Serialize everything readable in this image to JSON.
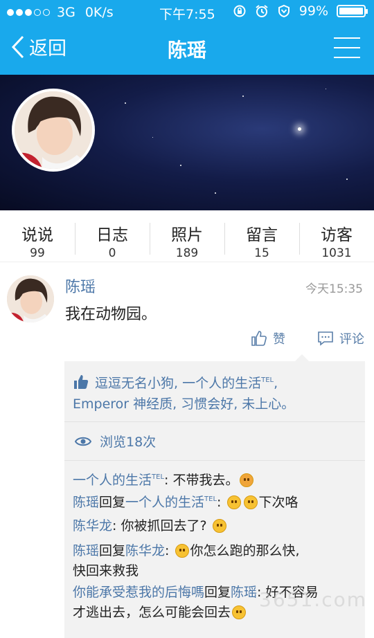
{
  "status": {
    "network": "3G",
    "speed": "0K/s",
    "time": "下午7:55",
    "battery": "99%",
    "battery_level": 0.99
  },
  "nav": {
    "back_label": "返回",
    "title": "陈瑶"
  },
  "stats": [
    {
      "label": "说说",
      "value": "99"
    },
    {
      "label": "日志",
      "value": "0"
    },
    {
      "label": "照片",
      "value": "189"
    },
    {
      "label": "留言",
      "value": "15"
    },
    {
      "label": "访客",
      "value": "1031"
    }
  ],
  "post": {
    "author": "陈瑶",
    "time": "今天15:35",
    "text": "我在动物园。",
    "like_label": "赞",
    "comment_label": "评论"
  },
  "likes": {
    "line1_a": "逗逗无名小狗, 一个人的生活",
    "tel": "TEL",
    "line1_b": ",",
    "line2": "Emperor 神经质, 习惯会好, 未上心。"
  },
  "views": "浏览18次",
  "comments": {
    "c1_name": "一个人的生活",
    "c1_text": ": 不带我去。",
    "c2_name": "陈瑶",
    "c2_reply": "回复",
    "c2_target": "一个人的生活",
    "c2_sep": ": ",
    "c2_text": "下次咯",
    "c3_name": "陈华龙",
    "c3_text": ": 你被抓回去了?",
    "c4_name": "陈瑶",
    "c4_reply": "回复",
    "c4_target": "陈华龙",
    "c4_sep": ": ",
    "c4_text": "你怎么跑的那么快,",
    "c4_text2": "快回来救我",
    "c5_name": "你能承受惹我的后悔嗎",
    "c5_reply": "回复",
    "c5_target": "陈瑶",
    "c5_text": ": 好不容易",
    "c5_text2": "才逃出去，怎么可能会回去"
  },
  "watermark": "3651.com"
}
